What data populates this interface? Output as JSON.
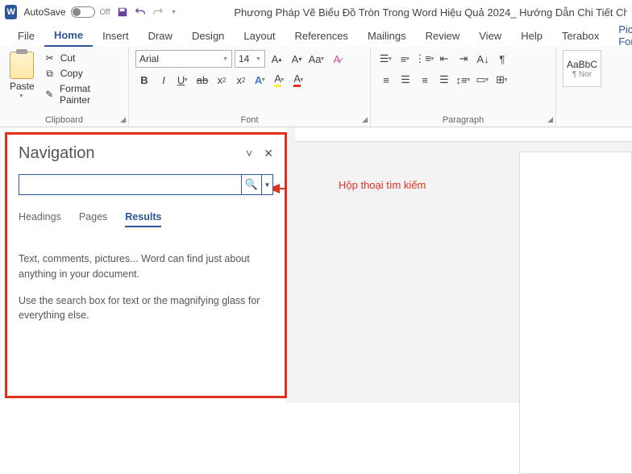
{
  "titlebar": {
    "autosave_label": "AutoSave",
    "autosave_state": "Off",
    "doc_title": "Phương Pháp Vẽ Biểu Đồ Tròn Trong Word Hiệu Quả 2024_ Hướng Dẫn Chi Tiết Cho Mọi Trình Đ"
  },
  "menu": {
    "file": "File",
    "home": "Home",
    "insert": "Insert",
    "draw": "Draw",
    "design": "Design",
    "layout": "Layout",
    "references": "References",
    "mailings": "Mailings",
    "review": "Review",
    "view": "View",
    "help": "Help",
    "terabox": "Terabox",
    "picture_format": "Picture Forma"
  },
  "ribbon": {
    "clipboard": {
      "label": "Clipboard",
      "paste": "Paste",
      "cut": "Cut",
      "copy": "Copy",
      "format_painter": "Format Painter"
    },
    "font": {
      "label": "Font",
      "name": "Arial",
      "size": "14"
    },
    "paragraph": {
      "label": "Paragraph"
    },
    "styles": {
      "sample": "AaBbC",
      "caption": "¶ Nor"
    }
  },
  "nav": {
    "title": "Navigation",
    "tabs": {
      "headings": "Headings",
      "pages": "Pages",
      "results": "Results"
    },
    "body1": "Text, comments, pictures... Word can find just about anything in your document.",
    "body2": "Use the search box for text or the magnifying glass for everything else."
  },
  "annotation": "Hộp thoại tìm kiếm"
}
